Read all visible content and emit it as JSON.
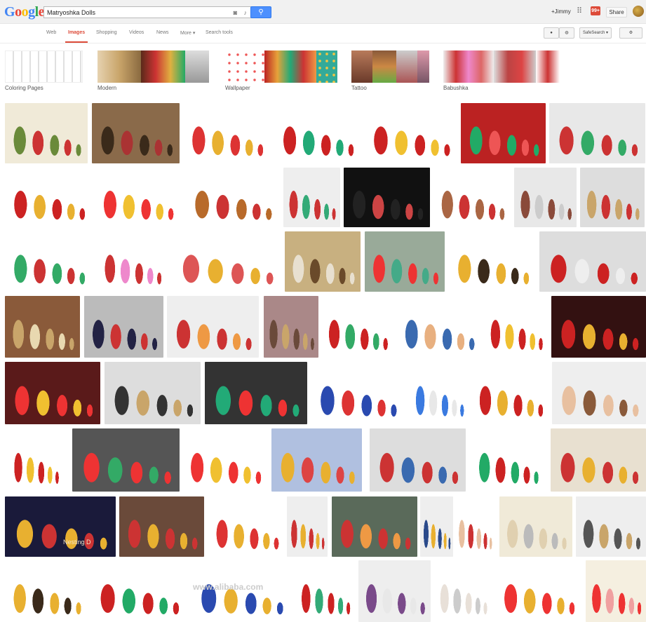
{
  "logo": {
    "letters": [
      "G",
      "o",
      "o",
      "g",
      "l",
      "e"
    ],
    "colors": [
      "#4285f4",
      "#ea4335",
      "#fbbc05",
      "#4285f4",
      "#34a853",
      "#ea4335"
    ]
  },
  "search": {
    "value": "Matryoshka Dolls"
  },
  "header": {
    "user": "+Jimmy",
    "notifications": "99+",
    "share": "Share"
  },
  "nav": {
    "tabs": [
      "Web",
      "Images",
      "Shopping",
      "Videos",
      "News",
      "More ▾",
      "Search tools"
    ],
    "safesearch": "SafeSearch ▾"
  },
  "related": [
    {
      "label": "Coloring Pages",
      "colors": [
        "#e8e8e8",
        "#f0f0f0"
      ]
    },
    {
      "label": "Modern",
      "colors": [
        "#c9a56a",
        "#7a4a2a",
        "#bbb"
      ]
    },
    {
      "label": "Wallpaper",
      "colors": [
        "#d44",
        "#e7a23a",
        "#5a9"
      ]
    },
    {
      "label": "Tattoo",
      "colors": [
        "#a55",
        "#6a4",
        "#c84"
      ]
    },
    {
      "label": "Babushka",
      "colors": [
        "#c33",
        "#b44",
        "#d66"
      ]
    }
  ],
  "watermarks": {
    "nesting": "Nesting D",
    "alibaba": "www.alibaba.com"
  }
}
